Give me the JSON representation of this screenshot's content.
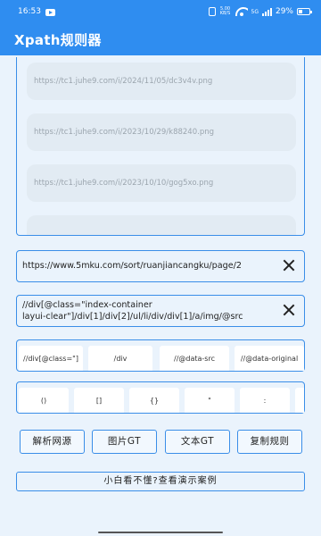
{
  "status_bar": {
    "time": "16:53",
    "network": "5.00 KB/S",
    "signal": "5G",
    "battery": "29%"
  },
  "app": {
    "title": "Xpath规则器"
  },
  "image_urls": [
    "https://tc1.juhe9.com/i/2024/11/05/dc3v4v.png",
    "https://tc1.juhe9.com/i/2023/10/29/k88240.png",
    "https://tc1.juhe9.com/i/2023/10/10/gog5xo.png"
  ],
  "url_input": {
    "value": "https://www.5mku.com/sort/ruanjiancangku/page/2"
  },
  "xpath_input": {
    "line1": "//div[@class=\"index-container",
    "line2": "layui-clear\"]/div[1]/div[2]/ul/li/div/div[1]/a/img/@src"
  },
  "snippets": [
    "//div[@class=\"]",
    "/div",
    "//@data-src",
    "//@data-original"
  ],
  "symbols": [
    "()",
    "[]",
    "{}",
    "\"",
    ":"
  ],
  "buttons": {
    "parse_source": "解析网源",
    "image_gt": "图片GT",
    "text_gt": "文本GT",
    "copy_rule": "复制规则"
  },
  "help_link": "小白看不懂?查看演示案例"
}
